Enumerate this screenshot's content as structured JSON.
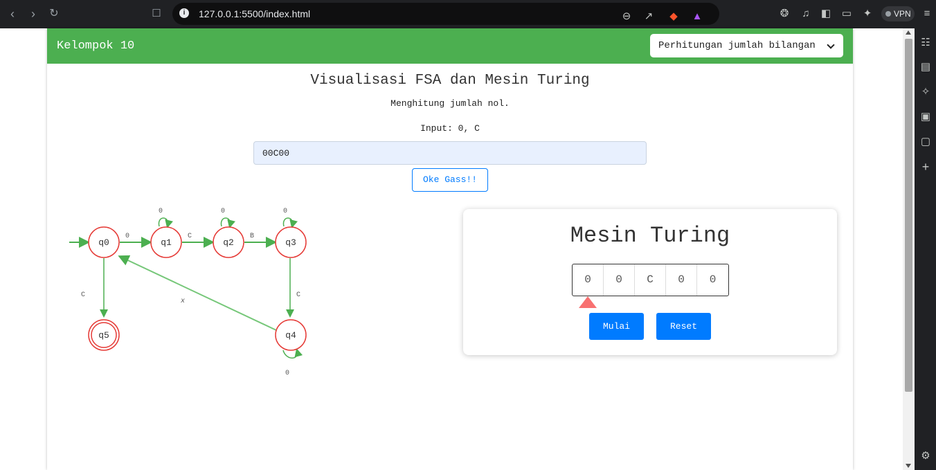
{
  "browser": {
    "url": "127.0.0.1:5500/index.html",
    "vpn_label": "VPN"
  },
  "navbar": {
    "brand": "Kelompok 10",
    "select_value": "Perhitungan jumlah bilangan"
  },
  "main": {
    "title": "Visualisasi FSA dan Mesin Turing",
    "subtitle": "Menghitung jumlah nol.",
    "input_label": "Input: 0, C",
    "input_value": "00C00",
    "submit_label": "Oke Gass!!"
  },
  "fsa": {
    "states": [
      "q0",
      "q1",
      "q2",
      "q3",
      "q4",
      "q5"
    ],
    "accepting_state": "q5",
    "transitions": [
      {
        "from": "q0",
        "to": "q1",
        "label": "0"
      },
      {
        "from": "q1",
        "to": "q2",
        "label": "C"
      },
      {
        "from": "q2",
        "to": "q3",
        "label": "B"
      },
      {
        "from": "q3",
        "to": "q4",
        "label": "C"
      },
      {
        "from": "q0",
        "to": "q5",
        "label": "C"
      },
      {
        "from": "q4",
        "to": "q0",
        "label": "x"
      },
      {
        "from": "q1",
        "to": "q1",
        "label": "0"
      },
      {
        "from": "q2",
        "to": "q2",
        "label": "0"
      },
      {
        "from": "q3",
        "to": "q3",
        "label": "0"
      },
      {
        "from": "q4",
        "to": "q4",
        "label": "0"
      }
    ],
    "colors": {
      "edge": "#4caf50",
      "state_border": "#e53935",
      "label": "#555555"
    }
  },
  "turing": {
    "title": "Mesin Turing",
    "tape": [
      "0",
      "0",
      "C",
      "0",
      "0"
    ],
    "head_position": 0,
    "start_label": "Mulai",
    "reset_label": "Reset"
  },
  "colors": {
    "primary_green": "#4caf50",
    "accent_blue": "#007bff",
    "head_color": "#f87171"
  }
}
